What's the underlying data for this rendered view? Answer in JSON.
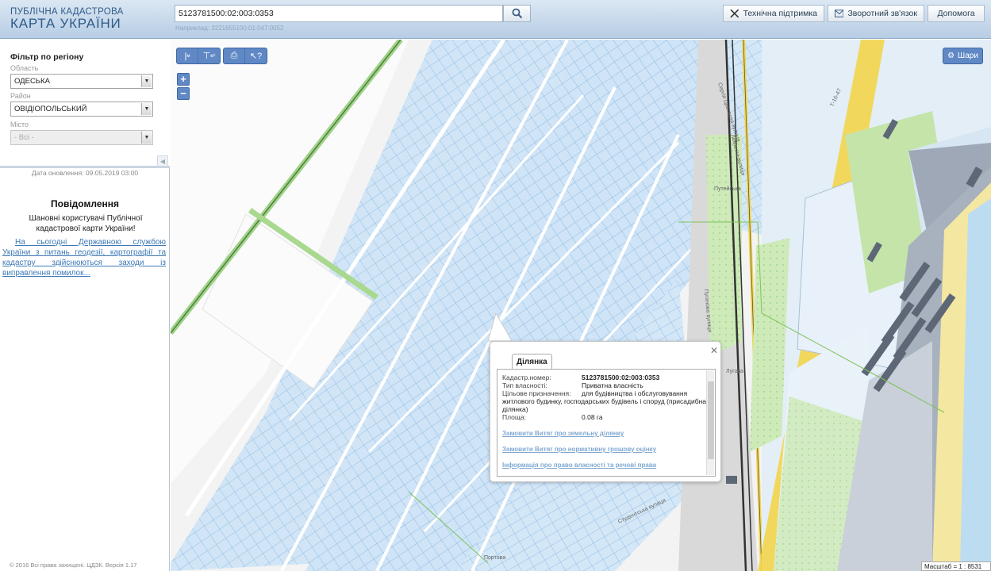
{
  "header": {
    "logo_line1": "ПУБЛІЧНА КАДАСТРОВА",
    "logo_line2": "КАРТА УКРАЇНИ",
    "search_value": "5123781500:02:003:0353",
    "search_hint": "Наприклад: 3221655100:01:047:0052",
    "tech_support": "Технічна підтримка",
    "feedback": "Зворотний зв'язок",
    "help": "Допомога"
  },
  "filter": {
    "title": "Фільтр по регіону",
    "region_label": "Область",
    "region_value": "ОДЕСЬКА",
    "district_label": "Район",
    "district_value": "ОВІДІОПОЛЬСЬКИЙ",
    "city_label": "Місто",
    "city_value": "- Всі -"
  },
  "sidebar": {
    "update_date": "Дата оновлення: 09.05.2019 03:00",
    "notice_title": "Повідомлення",
    "notice_greeting": "Шановні користувачі Публічної кадастрової карти України!",
    "notice_link": "На сьогодні Державною службою України з питань геодезії, картографії та кадастру здійснюються заходи із виправлення помилок...",
    "footer": "© 2016 Всі права захищені. ЦДЗК. Версія 1.17"
  },
  "map": {
    "layers_label": "Шари",
    "scale_text": "Масштаб = 1 : 8531",
    "street_labels": [
      "Сергія Цвєтаєва вулиця",
      "Пугачова вулиця",
      "Лиманна вулиця",
      "Студентська вулиця"
    ],
    "road_label": "Т-16-47",
    "place_labels": [
      "Лугова",
      "Путейська",
      "Портова"
    ],
    "colors": {
      "parcel_fill": "#cfe4f6",
      "parcel_stroke": "#8fbbe3",
      "green": "#b5e09a",
      "road_yellow": "#f2d54b",
      "beach": "#f4e7a1",
      "sea": "#bcdcf2",
      "built": "#8a95a6"
    }
  },
  "popup": {
    "tab_label": "Ділянка",
    "rows": [
      {
        "label": "Кадастр.номер:",
        "value": "5123781500:02:003:0353"
      },
      {
        "label": "Тип власності:",
        "value": "Приватна власність"
      },
      {
        "label": "Цільове призначення:",
        "value": "для будівництва і обслуговування житлового будинку, господарських будівель і споруд (присадибна ділянка)"
      },
      {
        "label": "Площа:",
        "value": "0.08 га"
      }
    ],
    "links": [
      "Замовити Витяг про земельну ділянку",
      "Замовити Витяг про нормативну грошову оцінку",
      "Інформація про право власності та речові права"
    ]
  }
}
